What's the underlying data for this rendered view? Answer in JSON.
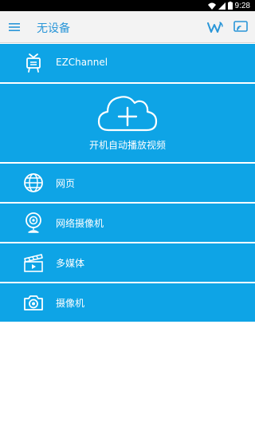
{
  "status_bar": {
    "time": "9:28"
  },
  "app_bar": {
    "title": "无设备"
  },
  "menu": {
    "channel": {
      "label": "EZChannel",
      "icon": "tv-icon"
    },
    "autoplay": {
      "label": "开机自动播放视频",
      "icon": "cloud-add-icon"
    },
    "items": [
      {
        "label": "网页",
        "icon": "globe-icon"
      },
      {
        "label": "网络摄像机",
        "icon": "webcam-icon"
      },
      {
        "label": "多媒体",
        "icon": "clapperboard-icon"
      },
      {
        "label": "摄像机",
        "icon": "camera-icon"
      }
    ]
  },
  "colors": {
    "accent": "#0ea4e6",
    "title": "#2a96d8",
    "appbar": "#f3f3f3"
  }
}
